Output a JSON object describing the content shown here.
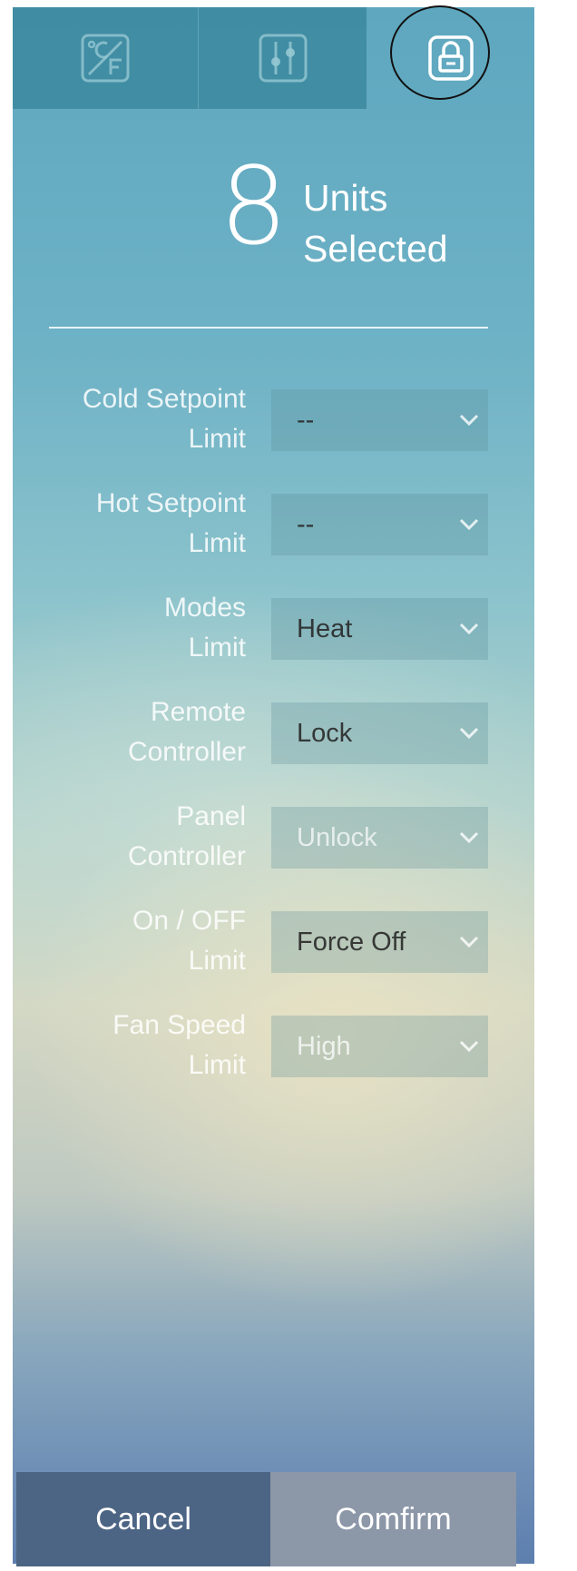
{
  "tabs": [
    {
      "name": "temperature-unit-tab",
      "icon": "celsius-fahrenheit-icon"
    },
    {
      "name": "settings-tab",
      "icon": "sliders-icon"
    },
    {
      "name": "lock-tab",
      "icon": "lock-icon",
      "active": true
    }
  ],
  "header": {
    "count": "8",
    "count_label_line1": "Units",
    "count_label_line2": "Selected"
  },
  "rows": [
    {
      "label_line1": "Cold Setpoint",
      "label_line2": "Limit",
      "value": "--"
    },
    {
      "label_line1": "Hot Setpoint",
      "label_line2": "Limit",
      "value": "--"
    },
    {
      "label_line1": "Modes",
      "label_line2": "Limit",
      "value": "Heat"
    },
    {
      "label_line1": "Remote",
      "label_line2": "Controller",
      "value": "Lock"
    },
    {
      "label_line1": "Panel",
      "label_line2": "Controller",
      "value": "Unlock"
    },
    {
      "label_line1": "On / OFF",
      "label_line2": "Limit",
      "value": "Force Off"
    },
    {
      "label_line1": "Fan Speed",
      "label_line2": "Limit",
      "value": "High"
    }
  ],
  "footer": {
    "cancel_label": "Cancel",
    "confirm_label": "Comfirm"
  },
  "colors": {
    "cancel_bg": "#4d6584",
    "confirm_bg": "#8c97a8",
    "tab_bg": "#26768c"
  }
}
